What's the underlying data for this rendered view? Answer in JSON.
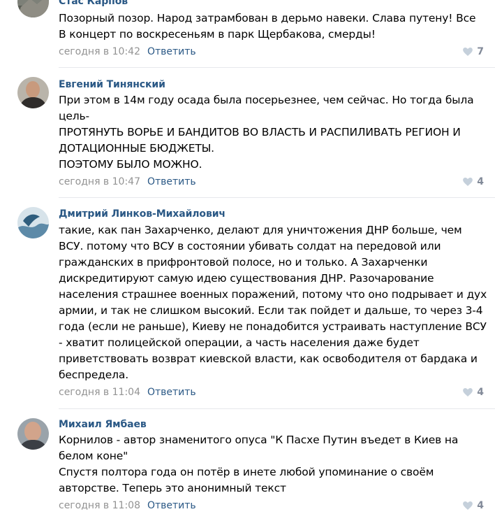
{
  "comments": [
    {
      "author": "Стас Карпов",
      "text": "Позорный позор. Народ затрамбован в дерьмо навеки. Слава путену! Все В концерт по воскресеньям в парк Щербакова, смерды!",
      "date": "сегодня в 10:42",
      "reply": "Ответить",
      "likes": "7"
    },
    {
      "author": "Евгений Тинянский",
      "text": "При этом в 14м году осада была посерьезнее, чем сейчас. Но тогда была цель-\nПРОТЯНУТЬ ВОРЬЕ И БАНДИТОВ ВО ВЛАСТЬ И РАСПИЛИВАТЬ РЕГИОН И ДОТАЦИОННЫЕ БЮДЖЕТЫ.\nПОЭТОМУ БЫЛО МОЖНО.",
      "date": "сегодня в 10:47",
      "reply": "Ответить",
      "likes": "4"
    },
    {
      "author": "Дмитрий Линков-Михайлович",
      "text": "такие, как пан Захарченко, делают для уничтожения ДНР больше, чем ВСУ. потому что ВСУ в состоянии убивать солдат на передовой или гражданских в прифронтовой полосе, но и только. А Захарченки дискредитируют самую идею существования ДНР. Разочарование населения страшнее военных поражений, потому что оно подрывает и дух армии, и так не слишком высокий. Если так пойдет и дальше, то через 3-4 года (если не раньше), Киеву не понадобится устраивать наступление ВСУ - хватит полицейской операции, а часть населения даже будет приветствовать возврат киевской власти, как освободителя от бардака и беспредела.",
      "date": "сегодня в 11:04",
      "reply": "Ответить",
      "likes": "4"
    },
    {
      "author": "Михаил Ямбаев",
      "text": "Корнилов - автор знаменитого опуса \"К Пасхе Путин въедет в Киев на белом коне\"\nСпустя полтора года он потёр в инете любой упоминание о своём авторстве. Теперь это анонимный текст",
      "date": "сегодня в 11:08",
      "reply": "Ответить",
      "likes": "4"
    }
  ],
  "colors": {
    "author": "#2a5885",
    "date": "#939393",
    "like_icon": "#c5d0db",
    "divider": "#e7e8ec"
  },
  "icons": {
    "like": "heart-icon"
  }
}
